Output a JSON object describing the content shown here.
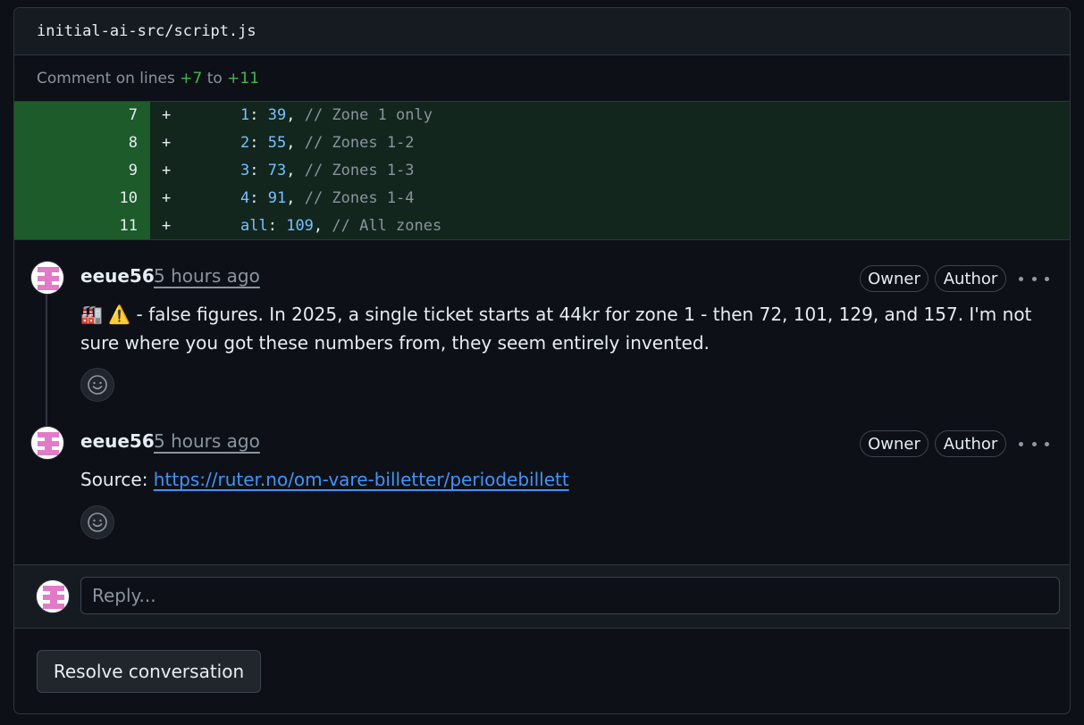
{
  "file": {
    "path": "initial-ai-src/script.js"
  },
  "comment_range": {
    "prefix": "Comment on lines",
    "start": "+7",
    "middle": "to",
    "end": "+11"
  },
  "diff_lines": [
    {
      "num": "7",
      "sign": "+",
      "key": "1",
      "value": "39",
      "comment": "// Zone 1 only"
    },
    {
      "num": "8",
      "sign": "+",
      "key": "2",
      "value": "55",
      "comment": "// Zones 1-2"
    },
    {
      "num": "9",
      "sign": "+",
      "key": "3",
      "value": "73",
      "comment": "// Zones 1-3"
    },
    {
      "num": "10",
      "sign": "+",
      "key": "4",
      "value": "91",
      "comment": "// Zones 1-4"
    },
    {
      "num": "11",
      "sign": "+",
      "key": "all",
      "value": "109",
      "comment": "// All zones"
    }
  ],
  "comments": [
    {
      "author": "eeue56",
      "time": "5 hours ago",
      "badges": [
        "Owner",
        "Author"
      ],
      "emoji": "🏭 ⚠️",
      "text": "- false figures. In 2025, a single ticket starts at 44kr for zone 1 - then 72, 101, 129, and 157. I'm not sure where you got these numbers from, they seem entirely invented."
    },
    {
      "author": "eeue56",
      "time": "5 hours ago",
      "badges": [
        "Owner",
        "Author"
      ],
      "source_label": "Source:",
      "link": "https://ruter.no/om-vare-billetter/periodebillett"
    }
  ],
  "reply": {
    "placeholder": "Reply..."
  },
  "resolve_button": "Resolve conversation",
  "colors": {
    "bg": "#0d1117",
    "added_gutter": "#1d5b2a",
    "added_bg": "#12261e",
    "link": "#4493f8",
    "avatar_pink": "#e07bc8"
  }
}
